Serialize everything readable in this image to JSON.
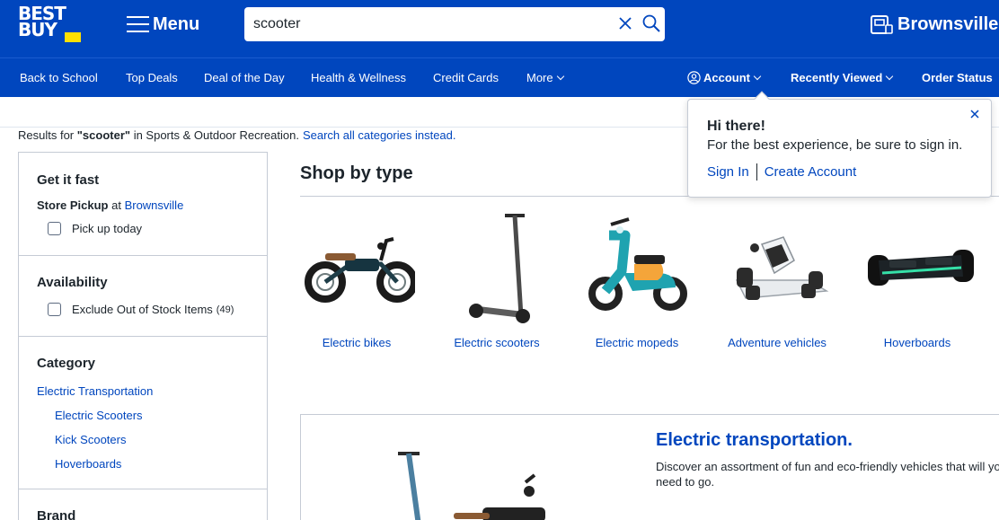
{
  "header": {
    "logo_line1": "BEST",
    "logo_line2": "BUY",
    "menu_label": "Menu",
    "search_value": "scooter",
    "store_name": "Brownsville"
  },
  "nav": {
    "left": [
      "Back to School",
      "Top Deals",
      "Deal of the Day",
      "Health & Wellness",
      "Credit Cards",
      "More"
    ],
    "account": "Account",
    "recently_viewed": "Recently Viewed",
    "order_status": "Order Status"
  },
  "results": {
    "prefix": "Results for",
    "query": "\"scooter\"",
    "suffix": "in Sports & Outdoor Recreation.",
    "link": "Search all categories instead."
  },
  "sidebar": {
    "get_it_fast": "Get it fast",
    "store_pickup_label": "Store Pickup",
    "store_pickup_at": "at",
    "store_pickup_store": "Brownsville",
    "pick_up_today": "Pick up today",
    "availability": "Availability",
    "exclude_oos": "Exclude Out of Stock Items",
    "exclude_oos_count": "(49)",
    "category": "Category",
    "category_links": [
      "Electric Transportation",
      "Electric Scooters",
      "Kick Scooters",
      "Hoverboards"
    ],
    "brand": "Brand"
  },
  "main": {
    "shop_by_type": "Shop by type",
    "tiles": [
      "Electric bikes",
      "Electric scooters",
      "Electric mopeds",
      "Adventure vehicles",
      "Hoverboards"
    ],
    "feature_title": "Electric transportation.",
    "feature_desc": "Discover an assortment of fun and eco-friendly vehicles that will you need to go."
  },
  "popover": {
    "title": "Hi there!",
    "text": "For the best experience, be sure to sign in.",
    "sign_in": "Sign In",
    "create_account": "Create Account"
  },
  "colors": {
    "brand_blue": "#0046be",
    "brand_yellow": "#ffe000",
    "text": "#1d252c",
    "border": "#c5cbd5"
  }
}
